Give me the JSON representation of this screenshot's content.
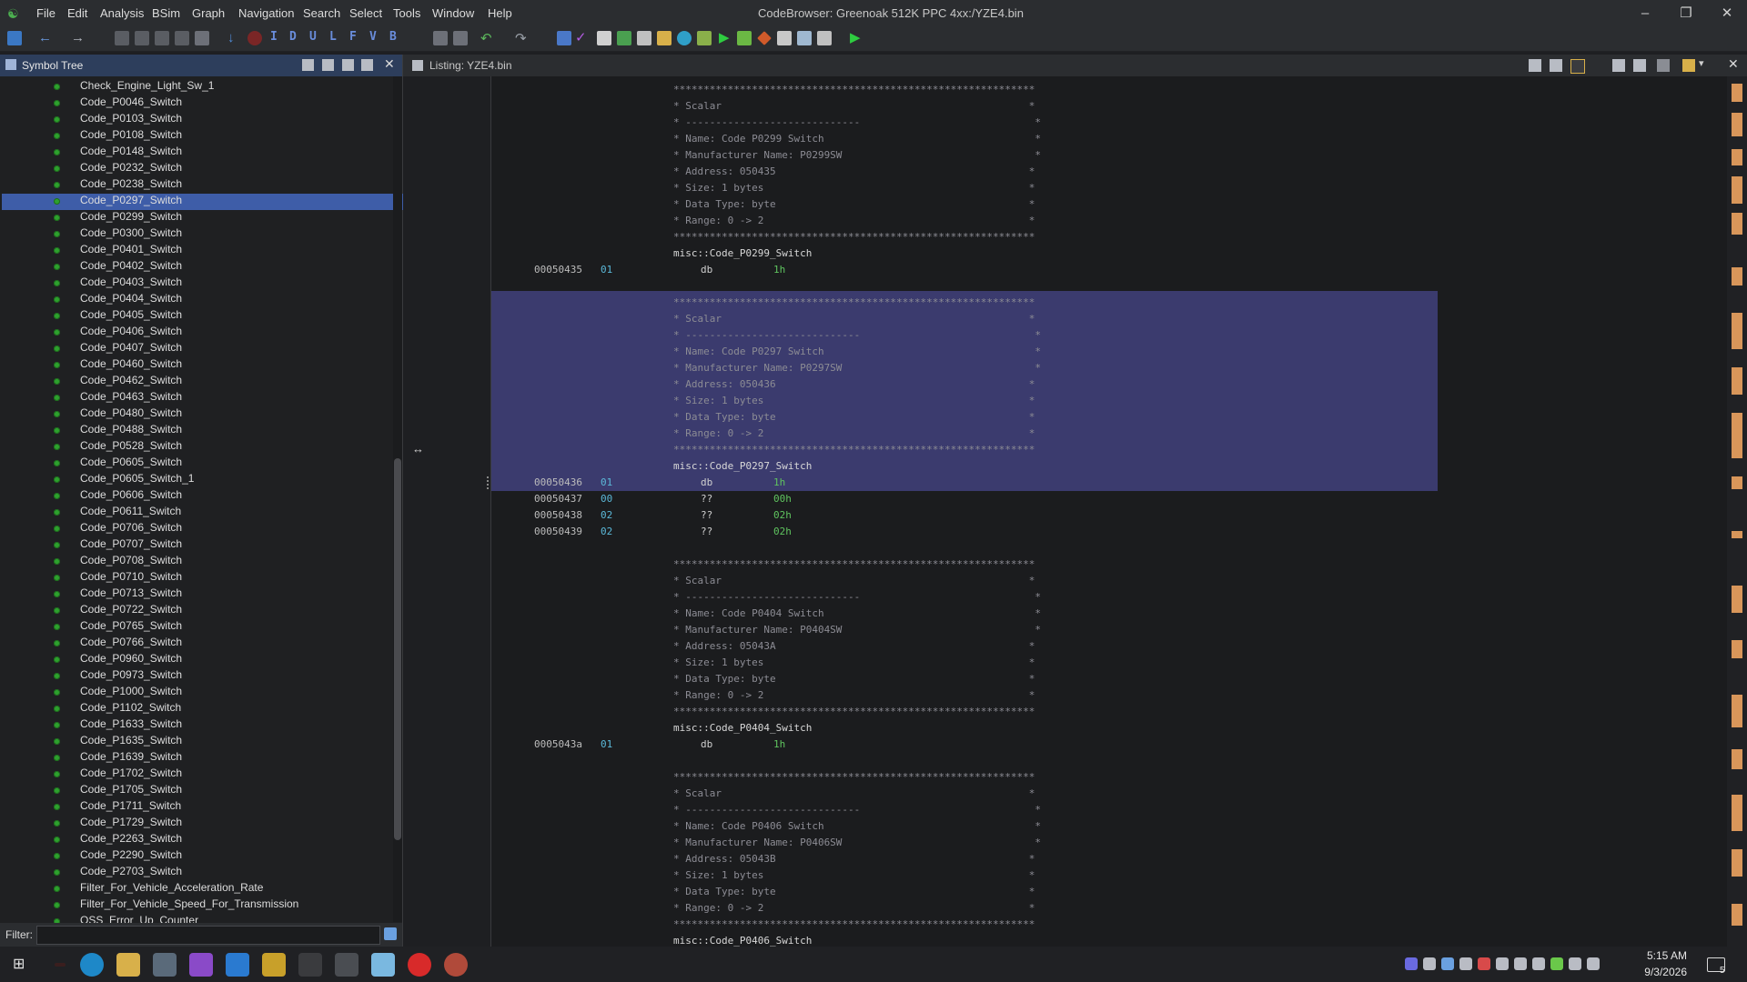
{
  "window": {
    "title": "CodeBrowser: Greenoak 512K PPC 4xx:/YZE4.bin"
  },
  "menu": [
    "File",
    "Edit",
    "Analysis",
    "BSim",
    "Graph",
    "Navigation",
    "Search",
    "Select",
    "Tools",
    "Window",
    "Help"
  ],
  "toolbar": {
    "letters": [
      "I",
      "D",
      "U",
      "L",
      "F",
      "V",
      "B"
    ]
  },
  "symbol_tree": {
    "title": "Symbol Tree",
    "selected_index": 7,
    "items": [
      "Check_Engine_Light_Sw_1",
      "Code_P0046_Switch",
      "Code_P0103_Switch",
      "Code_P0108_Switch",
      "Code_P0148_Switch",
      "Code_P0232_Switch",
      "Code_P0238_Switch",
      "Code_P0297_Switch",
      "Code_P0299_Switch",
      "Code_P0300_Switch",
      "Code_P0401_Switch",
      "Code_P0402_Switch",
      "Code_P0403_Switch",
      "Code_P0404_Switch",
      "Code_P0405_Switch",
      "Code_P0406_Switch",
      "Code_P0407_Switch",
      "Code_P0460_Switch",
      "Code_P0462_Switch",
      "Code_P0463_Switch",
      "Code_P0480_Switch",
      "Code_P0488_Switch",
      "Code_P0528_Switch",
      "Code_P0605_Switch",
      "Code_P0605_Switch_1",
      "Code_P0606_Switch",
      "Code_P0611_Switch",
      "Code_P0706_Switch",
      "Code_P0707_Switch",
      "Code_P0708_Switch",
      "Code_P0710_Switch",
      "Code_P0713_Switch",
      "Code_P0722_Switch",
      "Code_P0765_Switch",
      "Code_P0766_Switch",
      "Code_P0960_Switch",
      "Code_P0973_Switch",
      "Code_P1000_Switch",
      "Code_P1102_Switch",
      "Code_P1633_Switch",
      "Code_P1635_Switch",
      "Code_P1639_Switch",
      "Code_P1702_Switch",
      "Code_P1705_Switch",
      "Code_P1711_Switch",
      "Code_P1729_Switch",
      "Code_P2263_Switch",
      "Code_P2290_Switch",
      "Code_P2703_Switch",
      "Filter_For_Vehicle_Acceleration_Rate",
      "Filter_For_Vehicle_Speed_For_Transmission",
      "OSS_Error_Up_Counter"
    ],
    "filter_label": "Filter:"
  },
  "listing": {
    "title": "Listing:  YZE4.bin",
    "stars": "************************************************************",
    "lines": [
      {
        "t": "plate",
        "text": "************************************************************"
      },
      {
        "t": "plate",
        "text": "* Scalar                                                   *"
      },
      {
        "t": "plate",
        "text": "* -----------------------------                             *"
      },
      {
        "t": "plate",
        "text": "* Name: Code P0299 Switch                                   *"
      },
      {
        "t": "plate",
        "text": "* Manufacturer Name: P0299SW                                *"
      },
      {
        "t": "plate",
        "text": "* Address: 050435                                          *"
      },
      {
        "t": "plate",
        "text": "* Size: 1 bytes                                            *"
      },
      {
        "t": "plate",
        "text": "* Data Type: byte                                          *"
      },
      {
        "t": "plate",
        "text": "* Range: 0 -> 2                                            *"
      },
      {
        "t": "plate",
        "text": "************************************************************"
      },
      {
        "t": "label",
        "text": "misc::Code_P0299_Switch"
      },
      {
        "t": "code",
        "addr": "00050435",
        "bytes": "01",
        "mnem": "db",
        "oper": "1h"
      },
      {
        "t": "blank"
      },
      {
        "t": "plate",
        "text": "************************************************************"
      },
      {
        "t": "plate",
        "text": "* Scalar                                                   *"
      },
      {
        "t": "plate",
        "text": "* -----------------------------                             *"
      },
      {
        "t": "plate",
        "text": "* Name: Code P0297 Switch                                   *"
      },
      {
        "t": "plate",
        "text": "* Manufacturer Name: P0297SW                                *"
      },
      {
        "t": "plate",
        "text": "* Address: 050436                                          *"
      },
      {
        "t": "plate",
        "text": "* Size: 1 bytes                                            *"
      },
      {
        "t": "plate",
        "text": "* Data Type: byte                                          *"
      },
      {
        "t": "plate",
        "text": "* Range: 0 -> 2                                            *"
      },
      {
        "t": "plate",
        "text": "************************************************************"
      },
      {
        "t": "label",
        "text": "misc::Code_P0297_Switch"
      },
      {
        "t": "code",
        "addr": "00050436",
        "bytes": "01",
        "mnem": "db",
        "oper": "1h"
      },
      {
        "t": "code",
        "addr": "00050437",
        "bytes": "00",
        "mnem": "??",
        "oper": "00h"
      },
      {
        "t": "code",
        "addr": "00050438",
        "bytes": "02",
        "mnem": "??",
        "oper": "02h"
      },
      {
        "t": "code",
        "addr": "00050439",
        "bytes": "02",
        "mnem": "??",
        "oper": "02h"
      },
      {
        "t": "blank"
      },
      {
        "t": "plate",
        "text": "************************************************************"
      },
      {
        "t": "plate",
        "text": "* Scalar                                                   *"
      },
      {
        "t": "plate",
        "text": "* -----------------------------                             *"
      },
      {
        "t": "plate",
        "text": "* Name: Code P0404 Switch                                   *"
      },
      {
        "t": "plate",
        "text": "* Manufacturer Name: P0404SW                                *"
      },
      {
        "t": "plate",
        "text": "* Address: 05043A                                          *"
      },
      {
        "t": "plate",
        "text": "* Size: 1 bytes                                            *"
      },
      {
        "t": "plate",
        "text": "* Data Type: byte                                          *"
      },
      {
        "t": "plate",
        "text": "* Range: 0 -> 2                                            *"
      },
      {
        "t": "plate",
        "text": "************************************************************"
      },
      {
        "t": "label",
        "text": "misc::Code_P0404_Switch"
      },
      {
        "t": "code",
        "addr": "0005043a",
        "bytes": "01",
        "mnem": "db",
        "oper": "1h"
      },
      {
        "t": "blank"
      },
      {
        "t": "plate",
        "text": "************************************************************"
      },
      {
        "t": "plate",
        "text": "* Scalar                                                   *"
      },
      {
        "t": "plate",
        "text": "* -----------------------------                             *"
      },
      {
        "t": "plate",
        "text": "* Name: Code P0406 Switch                                   *"
      },
      {
        "t": "plate",
        "text": "* Manufacturer Name: P0406SW                                *"
      },
      {
        "t": "plate",
        "text": "* Address: 05043B                                          *"
      },
      {
        "t": "plate",
        "text": "* Size: 1 bytes                                            *"
      },
      {
        "t": "plate",
        "text": "* Data Type: byte                                          *"
      },
      {
        "t": "plate",
        "text": "* Range: 0 -> 2                                            *"
      },
      {
        "t": "plate",
        "text": "************************************************************"
      },
      {
        "t": "label",
        "text": "misc::Code_P0406_Switch"
      }
    ]
  },
  "taskbar": {
    "time": "5:15 AM",
    "date": "9/3/2026",
    "notification_count": "5"
  },
  "colors": {
    "selection": "#3e5da8",
    "highlight": "#3b3b6e",
    "operand": "#5fc45f",
    "bytes": "#5bb8d8",
    "node_dot": "#2ea12e"
  }
}
